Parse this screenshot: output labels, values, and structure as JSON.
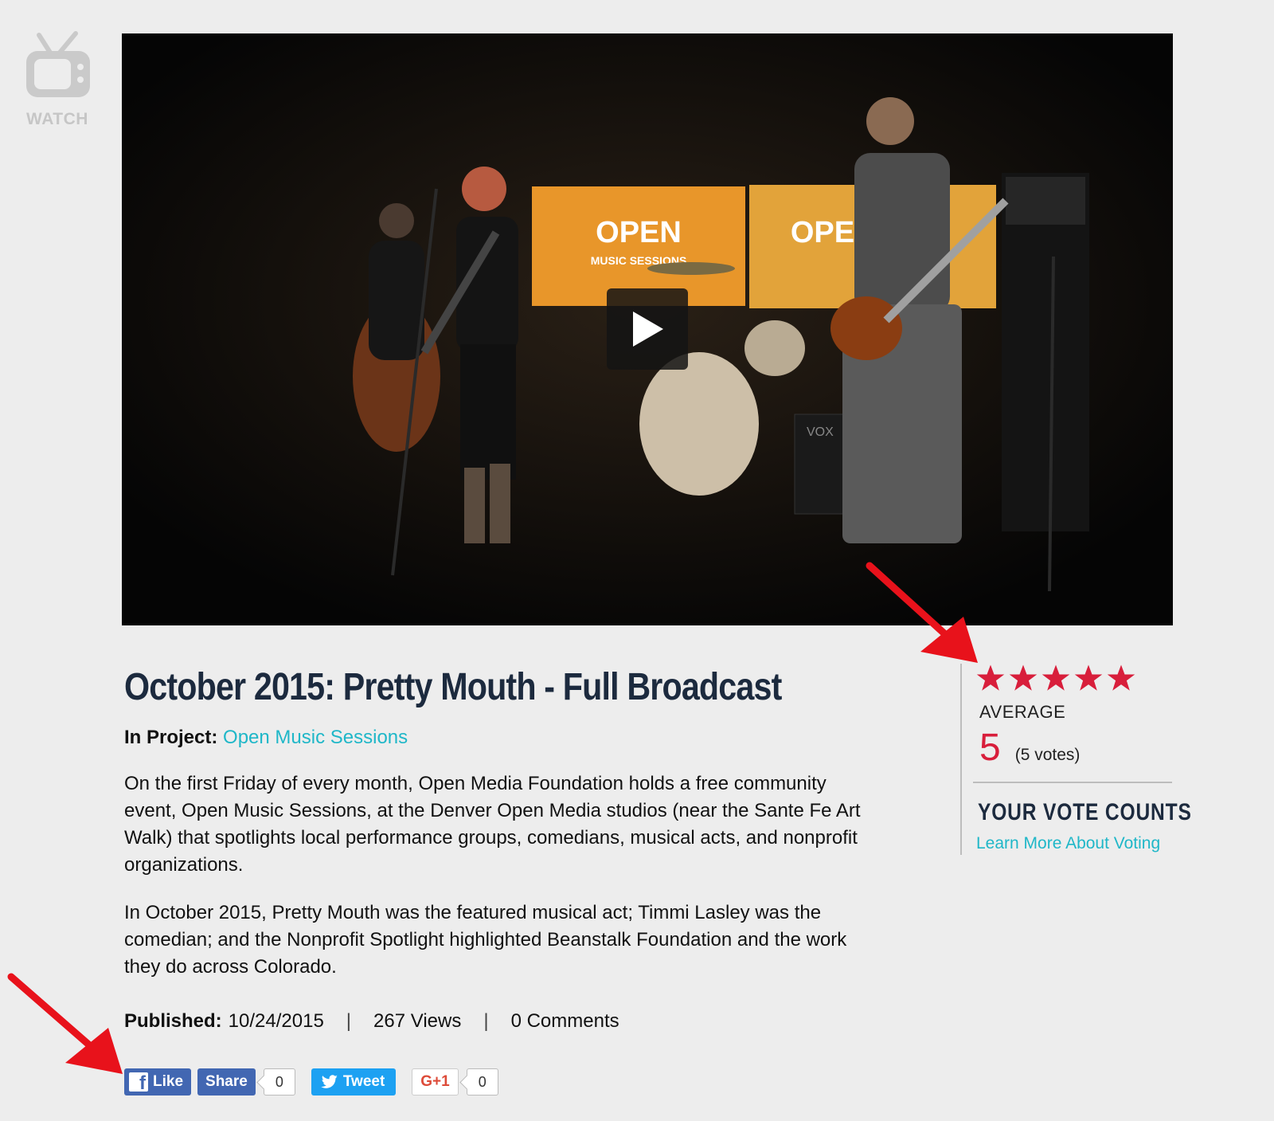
{
  "nav": {
    "watch_label": "WATCH"
  },
  "video": {
    "screen_logo_text": "OPEN",
    "screen_logo_subtext": "MUSIC SESSIONS",
    "amp_label": "VOX"
  },
  "title": "October 2015: Pretty Mouth - Full Broadcast",
  "project": {
    "label": "In Project:",
    "link_text": "Open Music Sessions"
  },
  "description": [
    "On the first Friday of every month, Open Media Foundation holds a free community event, Open Music Sessions, at the Denver Open Media studios (near the Sante Fe Art Walk) that spotlights local performance groups, comedians, musical acts, and nonprofit organizations.",
    "In October 2015, Pretty Mouth was the featured musical act; Timmi Lasley was the comedian; and the Nonprofit Spotlight highlighted Beanstalk Foundation and the work they do across Colorado."
  ],
  "meta": {
    "published_label": "Published:",
    "published_date": "10/24/2015",
    "views": "267 Views",
    "comments": "0 Comments",
    "separator": "|"
  },
  "social": {
    "like_label": "Like",
    "share_label": "Share",
    "facebook_count": "0",
    "tweet_label": "Tweet",
    "gplus_label": "G+1",
    "gplus_count": "0"
  },
  "rating": {
    "stars_filled": 5,
    "stars_total": 5,
    "average_label": "AVERAGE",
    "average_value": "5",
    "votes_text": "(5 votes)",
    "vote_counts_heading": "YOUR VOTE COUNTS",
    "learn_more_link": "Learn More About Voting"
  },
  "colors": {
    "star": "#d81e3b",
    "link": "#1fb7c8",
    "title": "#1c2a3e",
    "arrow": "#e8121b",
    "facebook": "#4267b2",
    "twitter": "#1da1f2"
  }
}
